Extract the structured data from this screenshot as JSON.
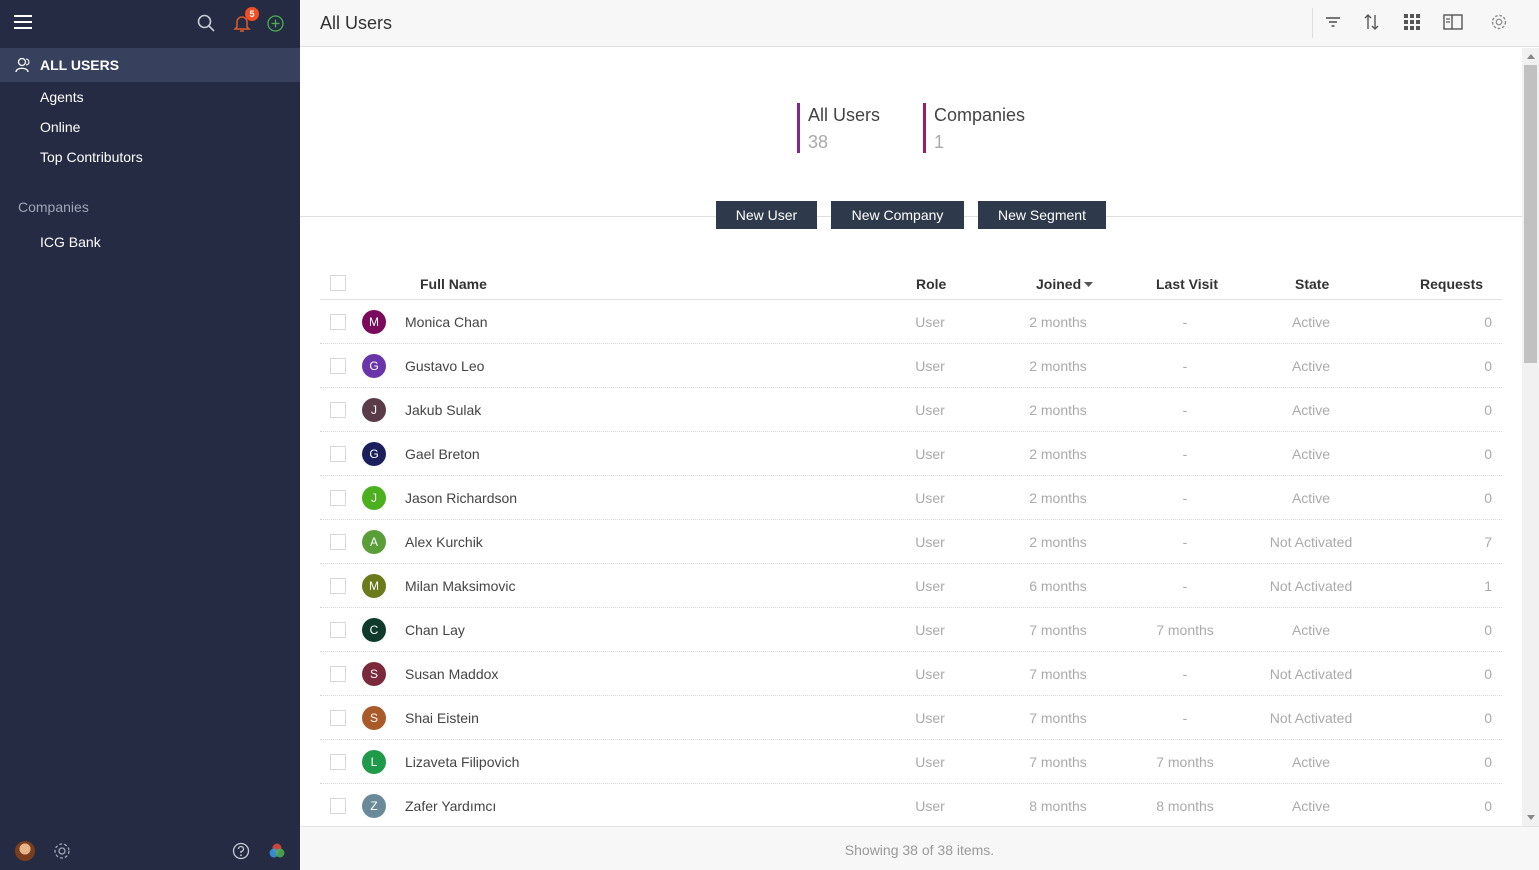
{
  "sidebar": {
    "notifications_count": "5",
    "active_item": "ALL USERS",
    "items": [
      "Agents",
      "Online",
      "Top Contributors"
    ],
    "companies_section": "Companies",
    "companies": [
      "ICG Bank"
    ]
  },
  "header": {
    "title": "All Users"
  },
  "stats": [
    {
      "label": "All Users",
      "value": "38",
      "color": "#7b2a8c"
    },
    {
      "label": "Companies",
      "value": "1",
      "color": "#9c1f5c"
    }
  ],
  "buttons": {
    "new_user": "New User",
    "new_company": "New Company",
    "new_segment": "New Segment"
  },
  "table": {
    "columns": {
      "full_name": "Full Name",
      "role": "Role",
      "joined": "Joined",
      "last_visit": "Last Visit",
      "state": "State",
      "requests": "Requests"
    },
    "rows": [
      {
        "initial": "M",
        "color": "#7a0b5c",
        "name": "Monica Chan",
        "role": "User",
        "joined": "2 months",
        "last_visit": "-",
        "state": "Active",
        "requests": "0"
      },
      {
        "initial": "G",
        "color": "#6a35a8",
        "name": "Gustavo Leo",
        "role": "User",
        "joined": "2 months",
        "last_visit": "-",
        "state": "Active",
        "requests": "0"
      },
      {
        "initial": "J",
        "color": "#5a3b48",
        "name": "Jakub Sulak",
        "role": "User",
        "joined": "2 months",
        "last_visit": "-",
        "state": "Active",
        "requests": "0"
      },
      {
        "initial": "G",
        "color": "#1b1f5c",
        "name": "Gael Breton",
        "role": "User",
        "joined": "2 months",
        "last_visit": "-",
        "state": "Active",
        "requests": "0"
      },
      {
        "initial": "J",
        "color": "#4caf1e",
        "name": "Jason Richardson",
        "role": "User",
        "joined": "2 months",
        "last_visit": "-",
        "state": "Active",
        "requests": "0"
      },
      {
        "initial": "A",
        "color": "#5a9e3a",
        "name": "Alex Kurchik",
        "role": "User",
        "joined": "2 months",
        "last_visit": "-",
        "state": "Not Activated",
        "requests": "7"
      },
      {
        "initial": "M",
        "color": "#6b7a1a",
        "name": "Milan Maksimovic",
        "role": "User",
        "joined": "6 months",
        "last_visit": "-",
        "state": "Not Activated",
        "requests": "1"
      },
      {
        "initial": "C",
        "color": "#0f3a2c",
        "name": "Chan Lay",
        "role": "User",
        "joined": "7 months",
        "last_visit": "7 months",
        "state": "Active",
        "requests": "0"
      },
      {
        "initial": "S",
        "color": "#7a2a3a",
        "name": "Susan Maddox",
        "role": "User",
        "joined": "7 months",
        "last_visit": "-",
        "state": "Not Activated",
        "requests": "0"
      },
      {
        "initial": "S",
        "color": "#a85a2a",
        "name": "Shai Eistein",
        "role": "User",
        "joined": "7 months",
        "last_visit": "-",
        "state": "Not Activated",
        "requests": "0"
      },
      {
        "initial": "L",
        "color": "#1e9a4a",
        "name": "Lizaveta Filipovich",
        "role": "User",
        "joined": "7 months",
        "last_visit": "7 months",
        "state": "Active",
        "requests": "0"
      },
      {
        "initial": "Z",
        "color": "#6a8a9a",
        "name": "Zafer Yardımcı",
        "role": "User",
        "joined": "8 months",
        "last_visit": "8 months",
        "state": "Active",
        "requests": "0"
      }
    ]
  },
  "footer": {
    "status": "Showing 38 of 38 items."
  }
}
